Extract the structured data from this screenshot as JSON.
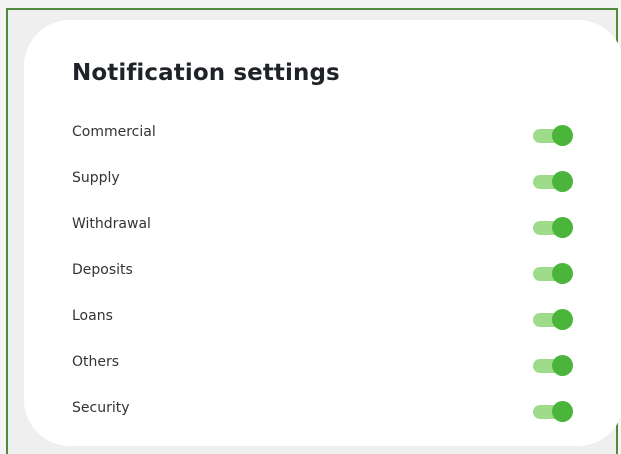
{
  "title": "Notification settings",
  "settings": [
    {
      "label": "Commercial",
      "enabled": true
    },
    {
      "label": "Supply",
      "enabled": true
    },
    {
      "label": "Withdrawal",
      "enabled": true
    },
    {
      "label": "Deposits",
      "enabled": true
    },
    {
      "label": "Loans",
      "enabled": true
    },
    {
      "label": "Others",
      "enabled": true
    },
    {
      "label": "Security",
      "enabled": true
    }
  ],
  "colors": {
    "frame_border": "#4f8a3a",
    "toggle_track_on": "#9edb8b",
    "toggle_knob_on": "#4ab53a"
  }
}
